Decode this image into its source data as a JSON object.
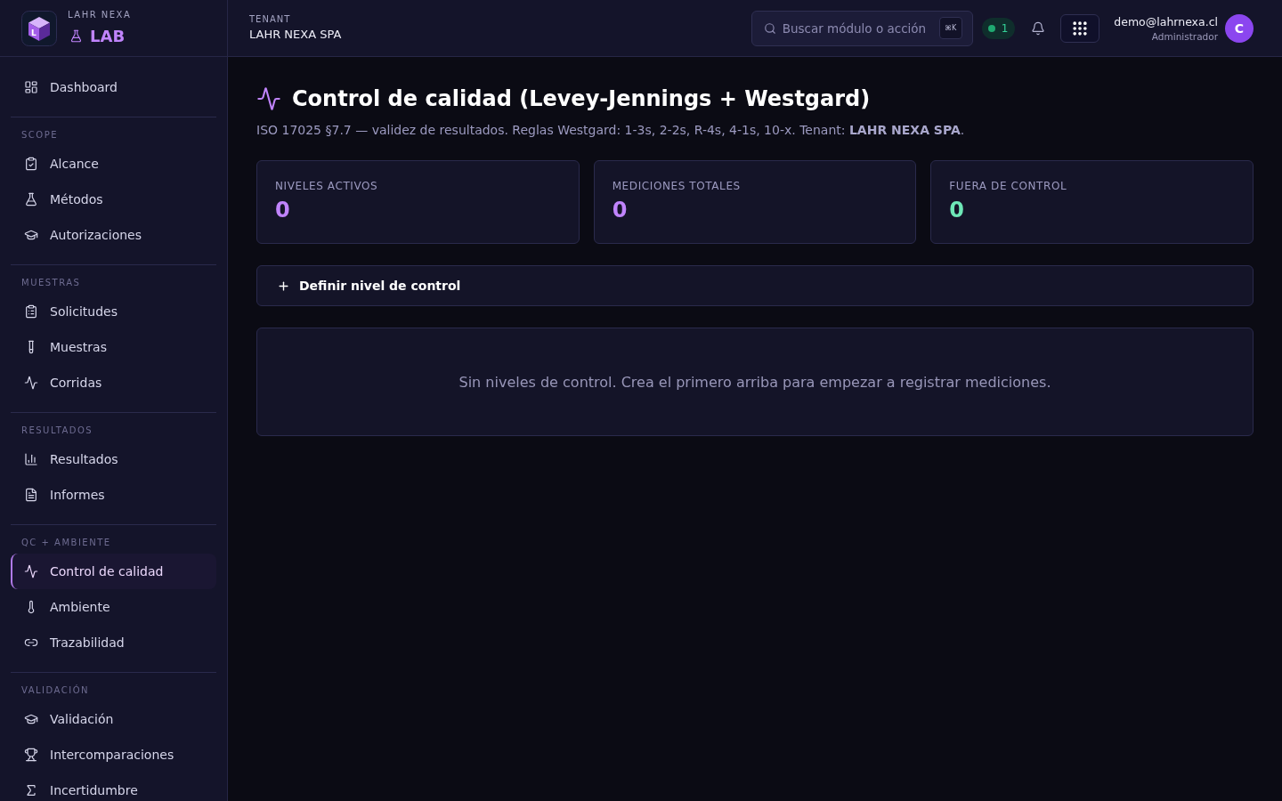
{
  "brand": {
    "logo_letter": "L",
    "org": "LAHR NEXA",
    "product": "LAB"
  },
  "topbar": {
    "tenant_label": "TENANT",
    "tenant_name": "LAHR NEXA SPA",
    "search": {
      "placeholder": "Buscar módulo o acción",
      "shortcut": "⌘K"
    },
    "status_badge": {
      "count": "1"
    },
    "user": {
      "email": "demo@lahrnexa.cl",
      "role": "Administrador",
      "initial": "C"
    }
  },
  "sidebar": {
    "items": [
      {
        "label": "Dashboard",
        "selected": false
      }
    ],
    "sections": [
      {
        "title": "SCOPE",
        "items": [
          {
            "label": "Alcance",
            "selected": false
          },
          {
            "label": "Métodos",
            "selected": false
          },
          {
            "label": "Autorizaciones",
            "selected": false
          }
        ]
      },
      {
        "title": "MUESTRAS",
        "items": [
          {
            "label": "Solicitudes",
            "selected": false
          },
          {
            "label": "Muestras",
            "selected": false
          },
          {
            "label": "Corridas",
            "selected": false
          }
        ]
      },
      {
        "title": "RESULTADOS",
        "items": [
          {
            "label": "Resultados",
            "selected": false
          },
          {
            "label": "Informes",
            "selected": false
          }
        ]
      },
      {
        "title": "QC + AMBIENTE",
        "items": [
          {
            "label": "Control de calidad",
            "selected": true
          },
          {
            "label": "Ambiente",
            "selected": false
          },
          {
            "label": "Trazabilidad",
            "selected": false
          }
        ]
      },
      {
        "title": "VALIDACIÓN",
        "items": [
          {
            "label": "Validación",
            "selected": false
          },
          {
            "label": "Intercomparaciones",
            "selected": false
          },
          {
            "label": "Incertidumbre",
            "selected": false
          }
        ]
      }
    ]
  },
  "page": {
    "title": "Control de calidad (Levey-Jennings + Westgard)",
    "subtitle": "ISO 17025 §7.7 — validez de resultados. Reglas Westgard: 1-3s, 2-2s, R-4s, 4-1s, 10-x. Tenant: **LAHR NEXA SPA**.",
    "stats": [
      {
        "label": "NIVELES ACTIVOS",
        "value": "0",
        "color": "#c084fc"
      },
      {
        "label": "MEDICIONES TOTALES",
        "value": "0",
        "color": "#c084fc"
      },
      {
        "label": "FUERA DE CONTROL",
        "value": "0",
        "color": "#6ee7b7"
      }
    ],
    "action": {
      "label": "Definir nivel de control"
    },
    "empty_state": {
      "message": "Sin niveles de control. Crea el primero arriba para empezar a registrar mediciones."
    }
  }
}
